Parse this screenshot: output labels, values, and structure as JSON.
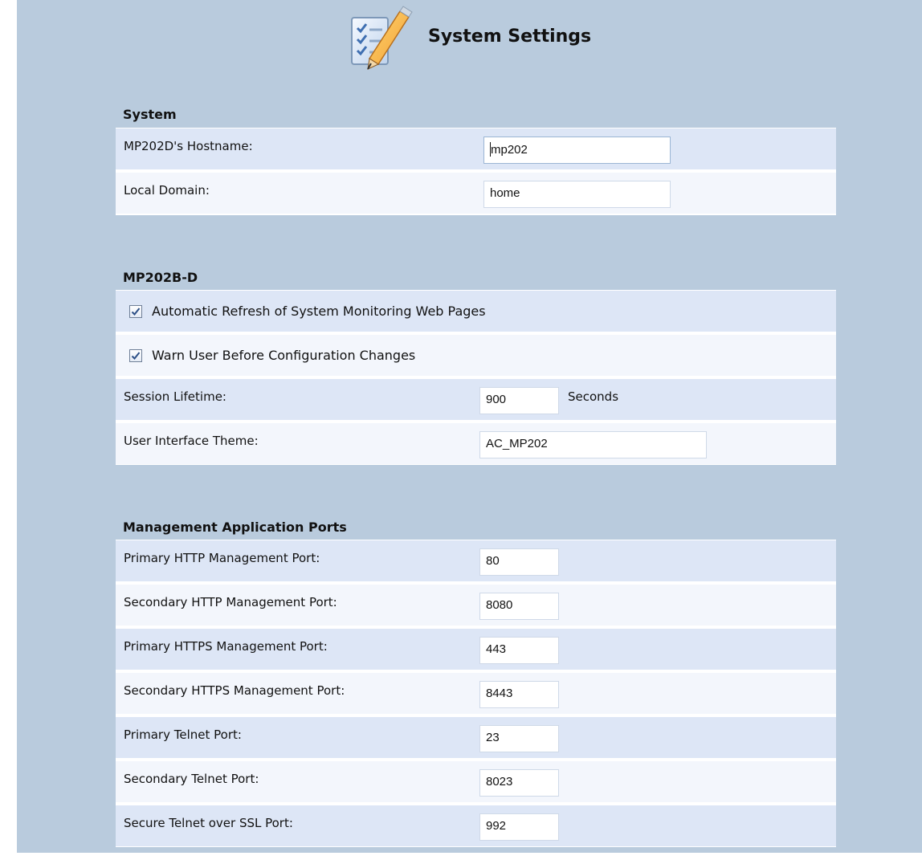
{
  "header": {
    "title": "System Settings",
    "icon": "checklist-pencil-icon"
  },
  "sections": [
    {
      "title": "System",
      "rows": [
        {
          "label": "MP202D's Hostname:",
          "value": "mp202",
          "type": "text"
        },
        {
          "label": "Local Domain:",
          "value": "home",
          "type": "text"
        }
      ]
    },
    {
      "title": "MP202B-D",
      "rows": [
        {
          "label": "Automatic Refresh of System Monitoring Web Pages",
          "checked": true,
          "type": "checkbox"
        },
        {
          "label": "Warn User Before Configuration Changes",
          "checked": true,
          "type": "checkbox"
        },
        {
          "label": "Session Lifetime:",
          "value": "900",
          "unit": "Seconds",
          "type": "text"
        },
        {
          "label": "User Interface Theme:",
          "value": "AC_MP202",
          "type": "text"
        }
      ]
    },
    {
      "title": "Management Application Ports",
      "rows": [
        {
          "label": "Primary HTTP Management Port:",
          "value": "80"
        },
        {
          "label": "Secondary HTTP Management Port:",
          "value": "8080"
        },
        {
          "label": "Primary HTTPS Management Port:",
          "value": "443"
        },
        {
          "label": "Secondary HTTPS Management Port:",
          "value": "8443"
        },
        {
          "label": "Primary Telnet Port:",
          "value": "23"
        },
        {
          "label": "Secondary Telnet Port:",
          "value": "8023"
        },
        {
          "label": "Secure Telnet over SSL Port:",
          "value": "992"
        }
      ]
    }
  ],
  "colors": {
    "panel_background": "#b9cbdd",
    "row_background": "#dde6f6",
    "row_alt_background": "#f3f6fc",
    "input_border": "#cfd9e8"
  }
}
